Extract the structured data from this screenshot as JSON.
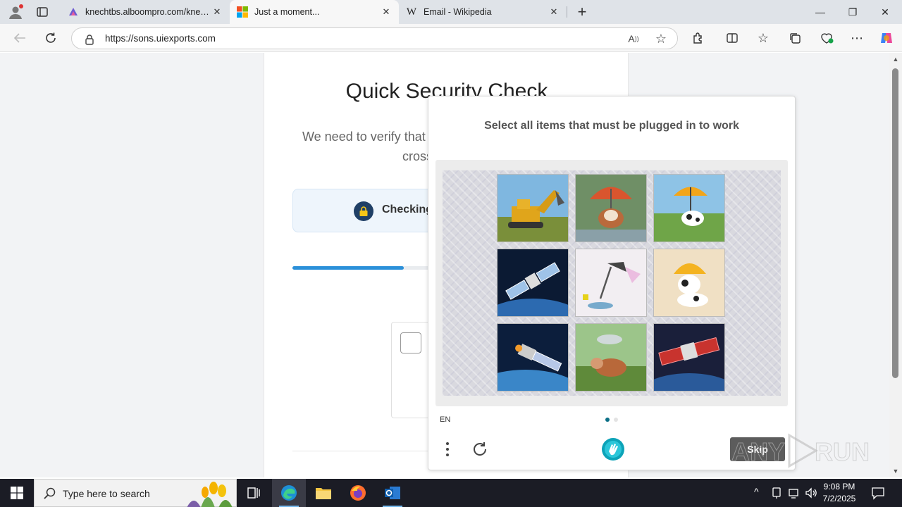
{
  "browser": {
    "tabs": [
      {
        "title": "knechtbs.alboompro.com/knechtb",
        "favicon": "alboom-icon",
        "active": false
      },
      {
        "title": "Just a moment...",
        "favicon": "microsoft-icon",
        "active": true
      },
      {
        "title": "Email - Wikipedia",
        "favicon": "wikipedia-icon",
        "active": false
      }
    ],
    "new_tab": "+",
    "url": "https://sons.uiexports.com"
  },
  "page": {
    "title": "Quick Security Check",
    "description": "We need to verify that                                   crosс",
    "desc_line1": "We need to verify that",
    "desc_line2": "cross",
    "checking_text": "Checking",
    "progress_percent": 36
  },
  "captcha": {
    "prompt": "Select all items that must be plugged in to work",
    "tiles": [
      {
        "subject": "excavator"
      },
      {
        "subject": "cow-with-umbrella"
      },
      {
        "subject": "cow-with-umbrella"
      },
      {
        "subject": "satellite"
      },
      {
        "subject": "desk-lamp"
      },
      {
        "subject": "cow-with-hat"
      },
      {
        "subject": "satellite"
      },
      {
        "subject": "cow"
      },
      {
        "subject": "satellite"
      }
    ],
    "language": "EN",
    "skip_label": "Skip",
    "page_indicator": {
      "current": 1,
      "total": 2
    }
  },
  "watermark": "ANY RUN",
  "taskbar": {
    "search_placeholder": "Type here to search",
    "time": "9:08 PM",
    "date": "7/2/2025"
  },
  "colors": {
    "accent": "#2b90d9",
    "captcha_dot": "#0b6f86",
    "taskbar": "#1b1c25"
  }
}
